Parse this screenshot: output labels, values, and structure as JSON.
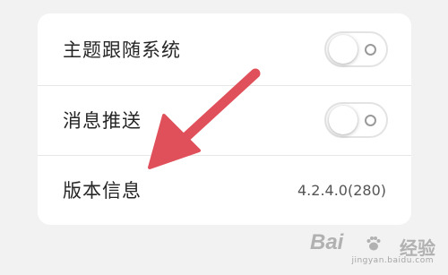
{
  "settings": {
    "rows": [
      {
        "label": "主题跟随系统",
        "type": "toggle",
        "on": false
      },
      {
        "label": "消息推送",
        "type": "toggle",
        "on": false
      },
      {
        "label": "版本信息",
        "type": "value",
        "value": "4.2.4.0(280)"
      }
    ]
  },
  "annotation": {
    "arrow_color": "#e0505a",
    "arrow_points_to": "版本信息"
  },
  "watermark": {
    "brand": "Bai",
    "sub": "经验",
    "url": "jingyan.baidu.com"
  },
  "colors": {
    "background": "#f2f2f2",
    "card": "#ffffff",
    "text": "#262626",
    "value_text": "#555555",
    "divider": "#e6e6e6"
  }
}
